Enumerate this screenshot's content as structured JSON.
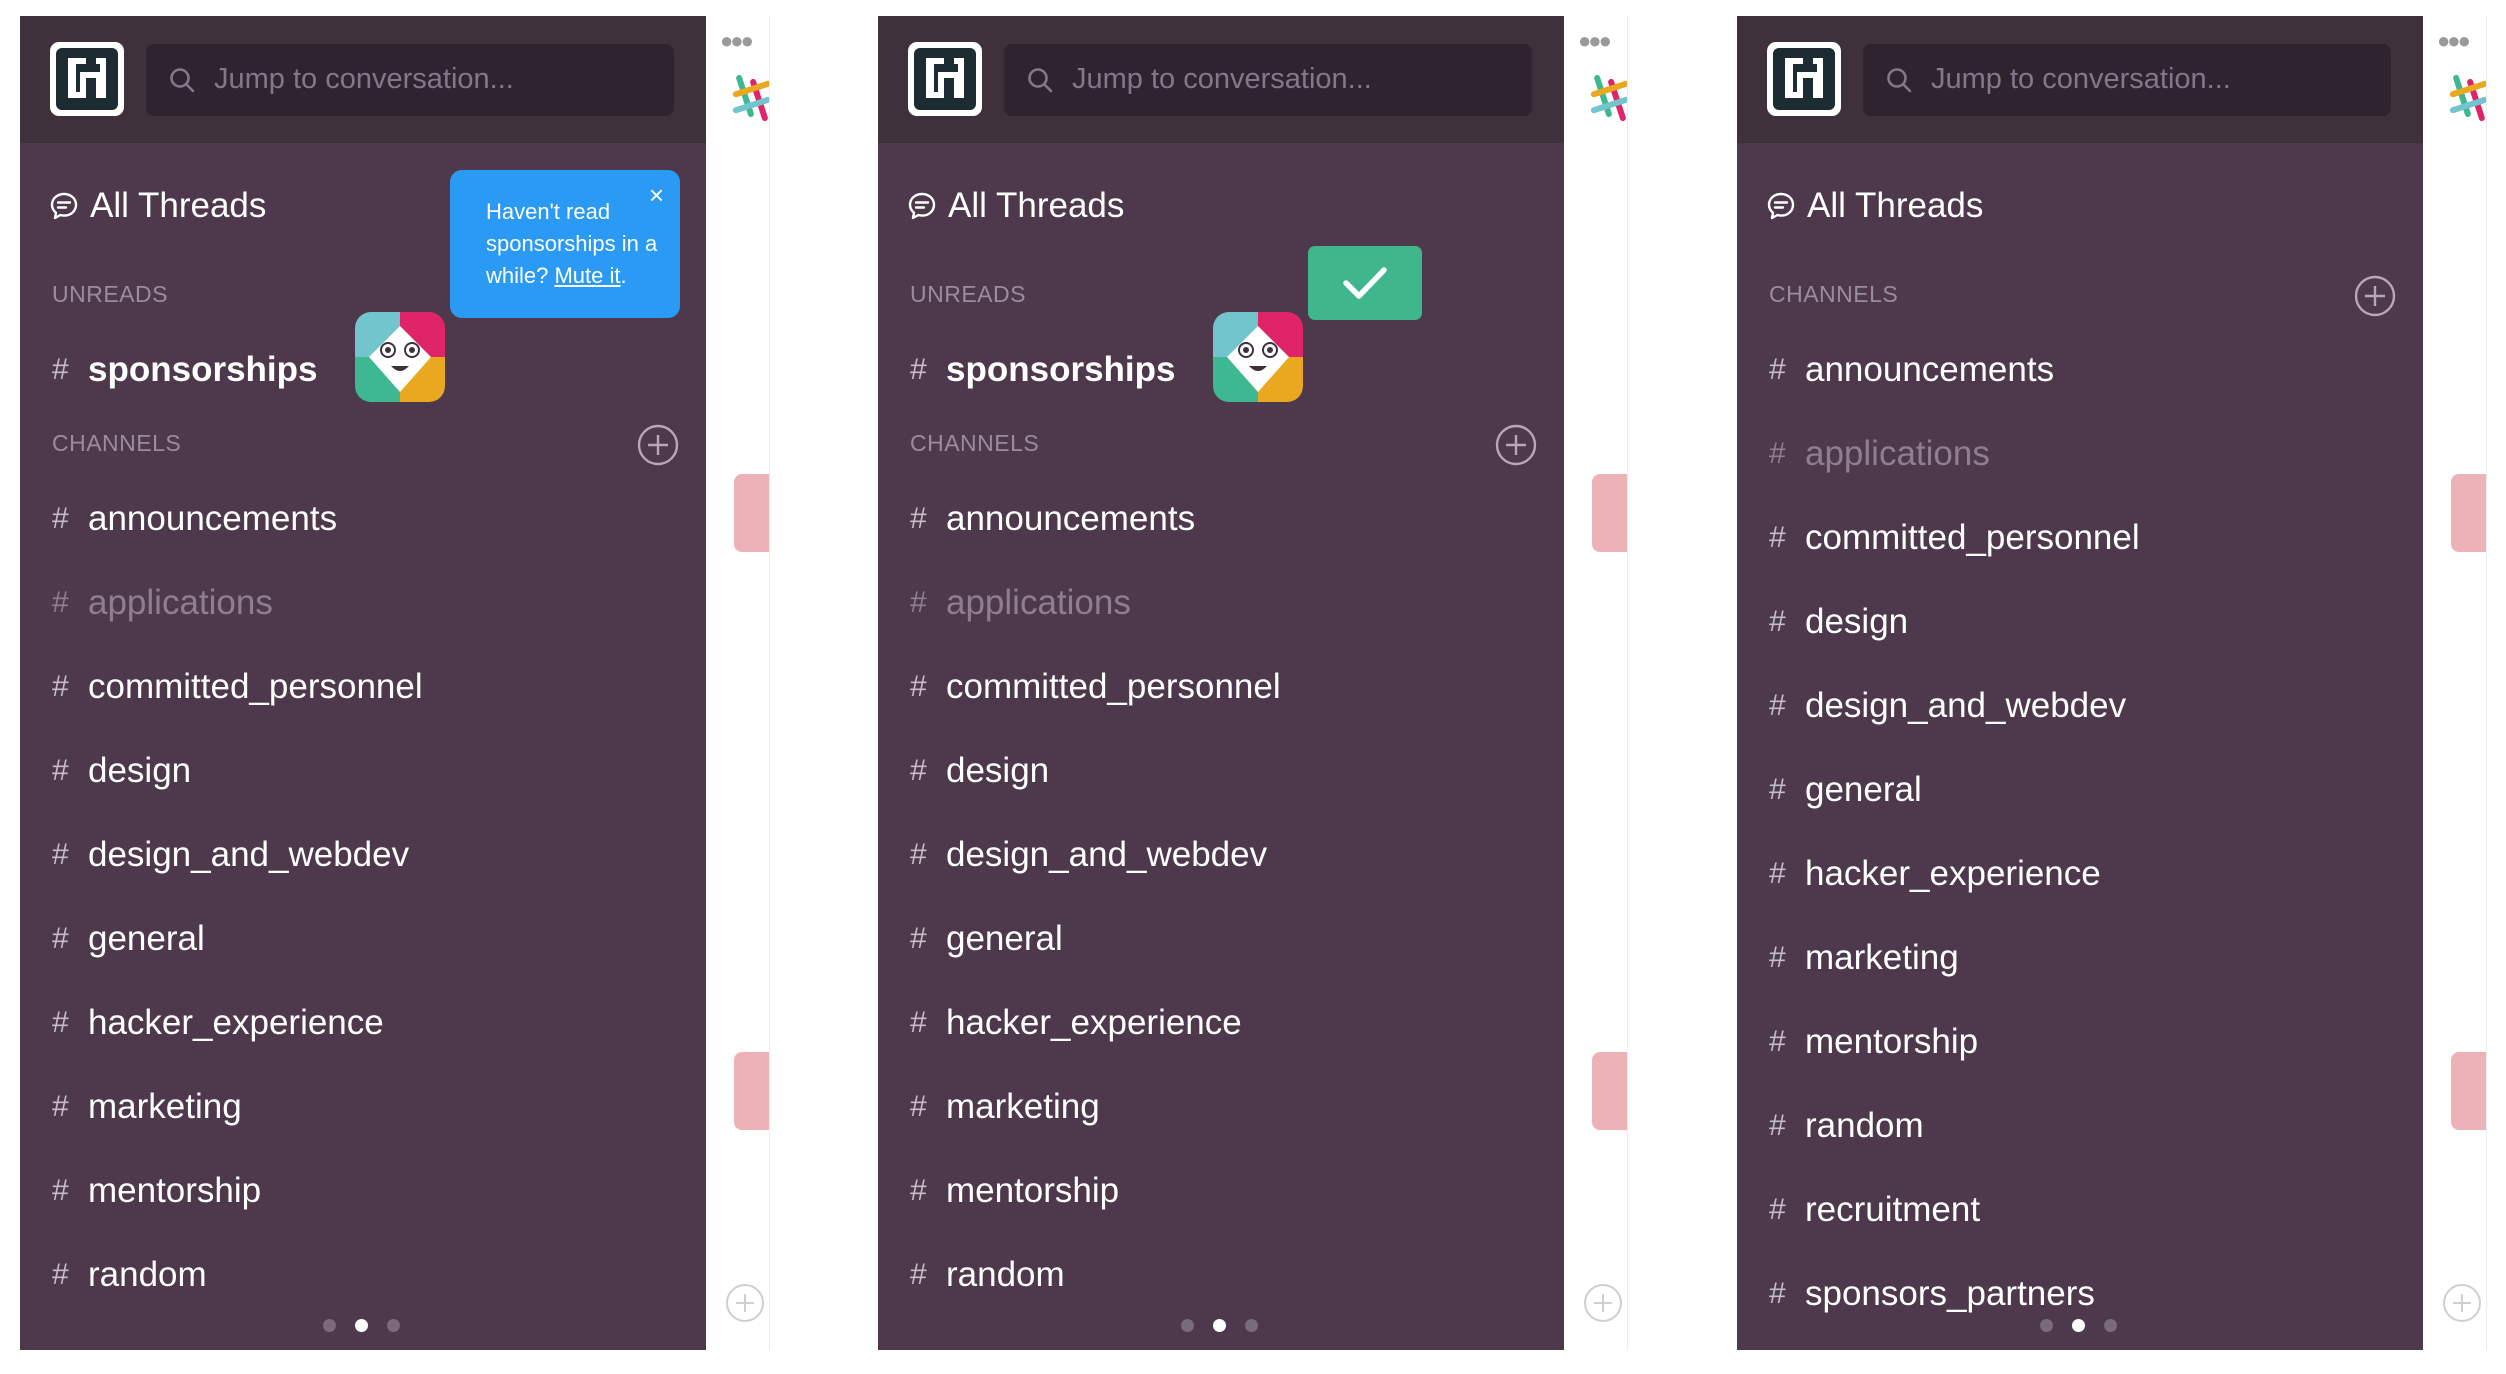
{
  "search": {
    "placeholder": "Jump to conversation..."
  },
  "all_threads_label": "All Threads",
  "panel1": {
    "unreads_header": "UNREADS",
    "unread_channel": "sponsorships",
    "channels_header": "CHANNELS",
    "channels": [
      {
        "name": "announcements",
        "muted": false
      },
      {
        "name": "applications",
        "muted": true
      },
      {
        "name": "committed_personnel",
        "muted": false
      },
      {
        "name": "design",
        "muted": false
      },
      {
        "name": "design_and_webdev",
        "muted": false
      },
      {
        "name": "general",
        "muted": false
      },
      {
        "name": "hacker_experience",
        "muted": false
      },
      {
        "name": "marketing",
        "muted": false
      },
      {
        "name": "mentorship",
        "muted": false
      },
      {
        "name": "random",
        "muted": false
      }
    ],
    "tooltip": {
      "text_before": "Haven't read sponsorships in a while? ",
      "link": "Mute it",
      "text_after": ".",
      "close": "×"
    },
    "pagination_active": 1
  },
  "panel2": {
    "unreads_header": "UNREADS",
    "unread_channel": "sponsorships",
    "channels_header": "CHANNELS",
    "channels": [
      {
        "name": "announcements",
        "muted": false
      },
      {
        "name": "applications",
        "muted": true
      },
      {
        "name": "committed_personnel",
        "muted": false
      },
      {
        "name": "design",
        "muted": false
      },
      {
        "name": "design_and_webdev",
        "muted": false
      },
      {
        "name": "general",
        "muted": false
      },
      {
        "name": "hacker_experience",
        "muted": false
      },
      {
        "name": "marketing",
        "muted": false
      },
      {
        "name": "mentorship",
        "muted": false
      },
      {
        "name": "random",
        "muted": false
      }
    ],
    "pagination_active": 1
  },
  "panel3": {
    "channels_header": "CHANNELS",
    "channels": [
      {
        "name": "announcements",
        "muted": false
      },
      {
        "name": "applications",
        "muted": true
      },
      {
        "name": "committed_personnel",
        "muted": false
      },
      {
        "name": "design",
        "muted": false
      },
      {
        "name": "design_and_webdev",
        "muted": false
      },
      {
        "name": "general",
        "muted": false
      },
      {
        "name": "hacker_experience",
        "muted": false
      },
      {
        "name": "marketing",
        "muted": false
      },
      {
        "name": "mentorship",
        "muted": false
      },
      {
        "name": "random",
        "muted": false
      },
      {
        "name": "recruitment",
        "muted": false
      },
      {
        "name": "sponsors_partners",
        "muted": false
      }
    ],
    "pagination_active": 1
  },
  "hash_symbol": "#",
  "peek_dots": "●●●",
  "colors": {
    "sidebar_bg": "#4d394b",
    "sidebar_header_bg": "#3e313c",
    "tooltip_bg": "#2a9af5",
    "check_badge_bg": "#3fb68b",
    "muted_text": "#8e7f8f"
  },
  "icons": [
    "team-logo-icon",
    "search-icon",
    "threads-icon",
    "add-channel-icon",
    "slackbot-icon",
    "checkmark-icon",
    "close-icon",
    "slack-logo-icon",
    "plus-icon"
  ]
}
